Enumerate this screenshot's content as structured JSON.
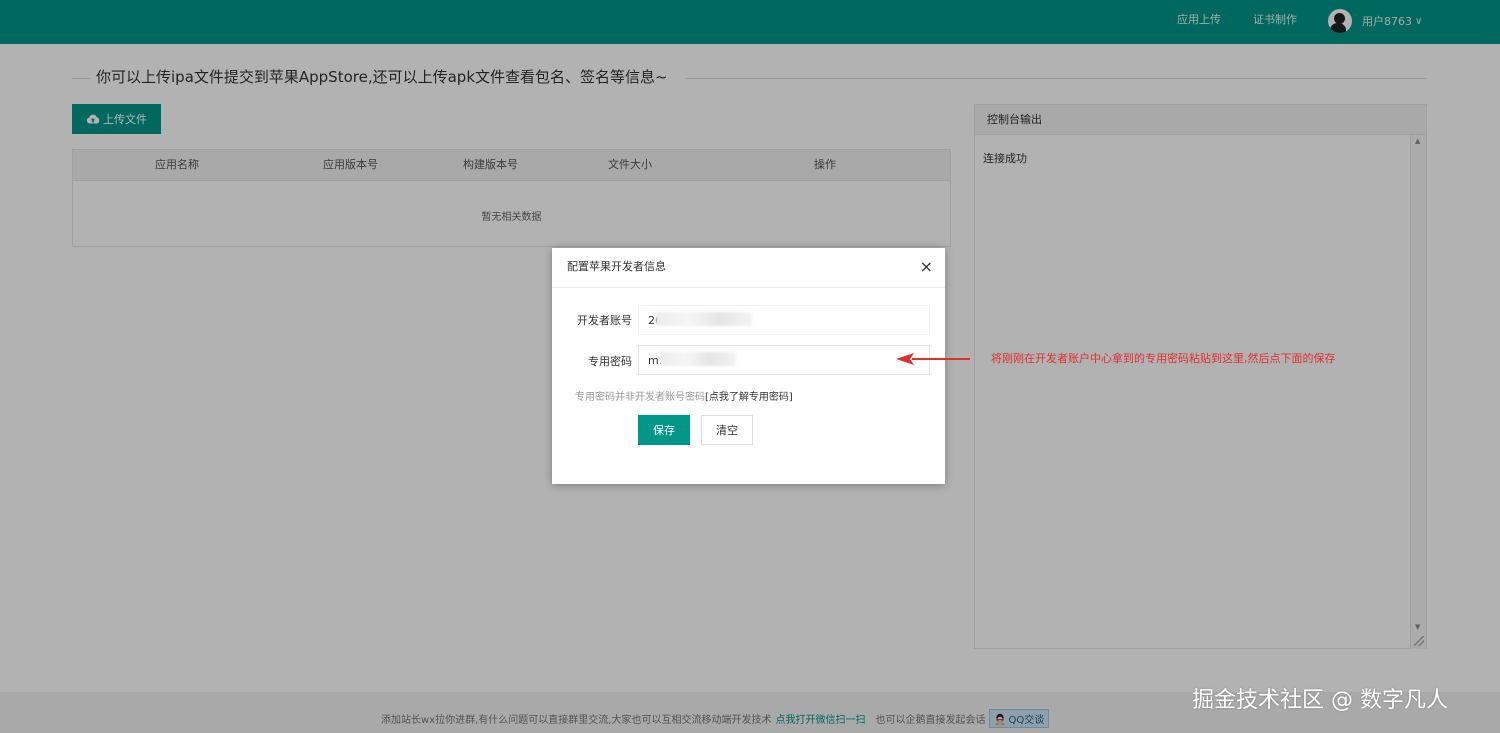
{
  "header": {
    "nav": [
      "应用上传",
      "证书制作"
    ],
    "user": "用户8763",
    "bg_color": "#009688"
  },
  "page": {
    "heading": "你可以上传ipa文件提交到苹果AppStore,还可以上传apk文件查看包名、签名等信息~",
    "upload_button": "上传文件",
    "table": {
      "columns": [
        "应用名称",
        "应用版本号",
        "构建版本号",
        "文件大小",
        "操作"
      ],
      "empty_text": "暂无相关数据"
    },
    "console": {
      "title": "控制台输出",
      "lines": [
        "连接成功"
      ]
    }
  },
  "footer": {
    "text": "添加站长wx拉你进群,有什么问题可以直接群里交流,大家也可以互相交流移动端开发技术",
    "link": "点我打开微信扫一扫",
    "text2": "也可以企鹅直接发起会话",
    "qq_button": "QQ交谈",
    "watermark": "掘金技术社区 @ 数字凡人"
  },
  "modal": {
    "title": "配置苹果开发者信息",
    "close": "×",
    "account_label": "开发者账号",
    "account_value": "26",
    "password_label": "专用密码",
    "password_value": "m.",
    "hint": "专用密码并非开发者账号密码",
    "hint_link": "[点我了解专用密码]",
    "save": "保存",
    "clear": "清空"
  },
  "annotation": {
    "text": "将刚刚在开发者账户中心拿到的专用密码粘贴到这里,然后点下面的保存",
    "color": "#e0302d"
  },
  "icons": [
    "cloud-upload-icon",
    "close-icon",
    "chevron-down-icon",
    "qq-icon",
    "arrow-left-icon"
  ]
}
